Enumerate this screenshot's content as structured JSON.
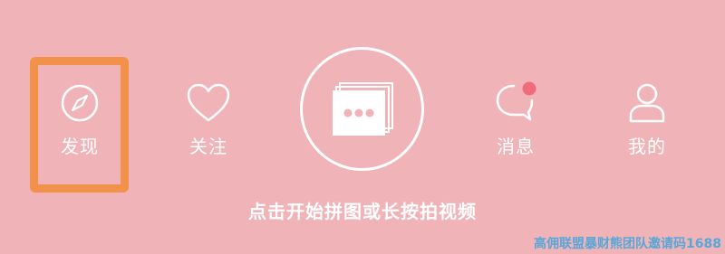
{
  "tabs": {
    "discover": {
      "label": "发现",
      "icon": "compass-icon"
    },
    "follow": {
      "label": "关注",
      "icon": "heart-icon"
    },
    "messages": {
      "label": "消息",
      "icon": "chat-bubble-icon",
      "has_unread_dot": true
    },
    "me": {
      "label": "我的",
      "icon": "person-icon"
    }
  },
  "center_button": {
    "icon": "stacked-photos-more-icon"
  },
  "hint_text": "点击开始拼图或长按拍视频",
  "watermark": "高佣联盟暴财熊团队邀请码1688",
  "colors": {
    "background": "#f0b4b8",
    "foreground": "#ffffff",
    "highlight": "#f2924a",
    "badge": "#f26b7a",
    "watermark": "#58a6d8"
  }
}
